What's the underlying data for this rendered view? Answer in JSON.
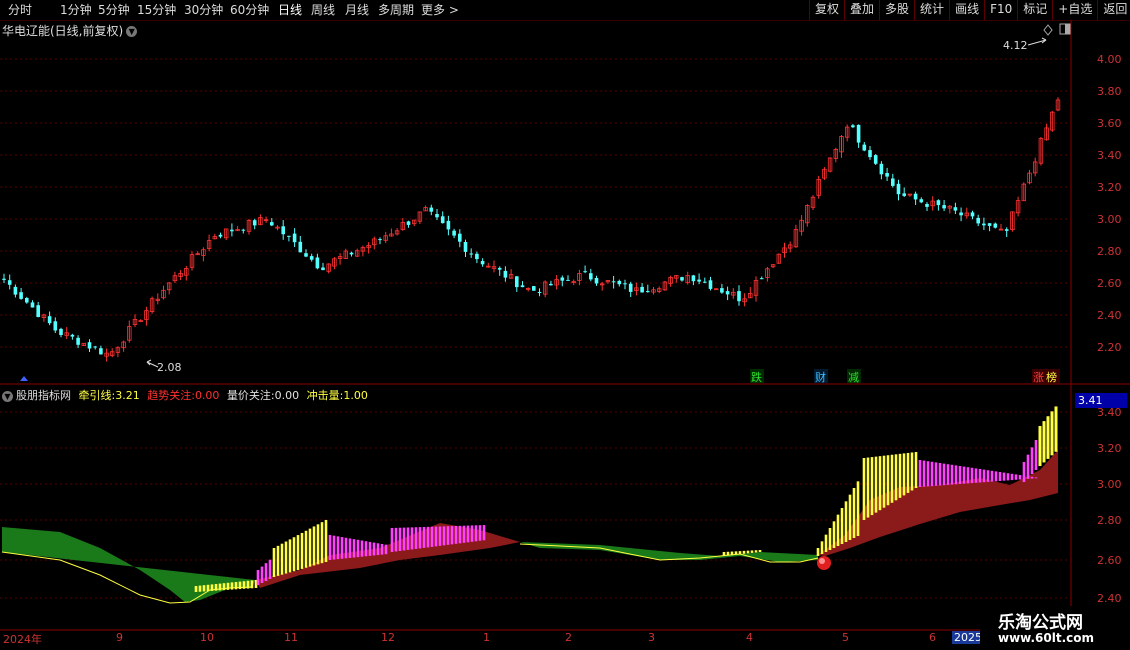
{
  "toolbar": {
    "periods": [
      "分时",
      "1分钟",
      "5分钟",
      "15分钟",
      "30分钟",
      "60分钟",
      "日线",
      "周线",
      "月线",
      "多周期",
      "更多 >"
    ],
    "active_period": "日线",
    "actions": [
      "复权",
      "叠加",
      "多股",
      "统计",
      "画线",
      "F10",
      "标记",
      "+自选",
      "返回"
    ]
  },
  "stock": {
    "title": "华电辽能(日线,前复权)"
  },
  "indicator": {
    "name": "股朋指标网",
    "items": [
      {
        "label": "牵引线:",
        "value": "3.21",
        "color": "#ffff40"
      },
      {
        "label": "趋势关注:",
        "value": "0.00",
        "color": "#ff3030"
      },
      {
        "label": "量价关注:",
        "value": "0.00",
        "color": "#e0e0e0"
      },
      {
        "label": "冲击量:",
        "value": "1.00",
        "color": "#ffff40"
      }
    ],
    "current_value": "3.41"
  },
  "price_axis": {
    "ticks": [
      "4.00",
      "3.80",
      "3.60",
      "3.40",
      "3.20",
      "3.00",
      "2.80",
      "2.60",
      "2.40",
      "2.20"
    ]
  },
  "indicator_axis": {
    "ticks": [
      "3.40",
      "3.20",
      "3.00",
      "2.80",
      "2.60",
      "2.40"
    ]
  },
  "annotations": {
    "high": "4.12",
    "low": "2.08"
  },
  "events": [
    {
      "text": "跌",
      "color": "#30e030",
      "bg": "#004000"
    },
    {
      "text": "财",
      "color": "#40c0ff",
      "bg": "#002040"
    },
    {
      "text": "减",
      "color": "#30e030",
      "bg": "#004000"
    },
    {
      "text": "涨",
      "color": "#ff4040",
      "bg": "#400000"
    },
    {
      "text": "榜",
      "color": "#ffff40",
      "bg": "#400000"
    }
  ],
  "date_axis": {
    "labels": [
      "2024年",
      "9",
      "10",
      "11",
      "12",
      "1",
      "2",
      "3",
      "4",
      "5",
      "6",
      "2025"
    ]
  },
  "watermark": {
    "title": "乐淘公式网",
    "url": "www.60lt.com"
  },
  "chart_data": {
    "type": "candlestick",
    "title": "华电辽能(日线,前复权)",
    "ylim": [
      2.1,
      4.2
    ],
    "high_marker": 4.12,
    "low_marker": 2.08,
    "close_trend": [
      {
        "x": "2024-08",
        "y": 2.62
      },
      {
        "x": "2024-09",
        "y": 2.3
      },
      {
        "x": "2024-09-20",
        "y": 2.15
      },
      {
        "x": "2024-10",
        "y": 2.55
      },
      {
        "x": "2024-10-20",
        "y": 2.9
      },
      {
        "x": "2024-11",
        "y": 3.0
      },
      {
        "x": "2024-11-20",
        "y": 2.7
      },
      {
        "x": "2024-12",
        "y": 2.85
      },
      {
        "x": "2024-12-20",
        "y": 3.05
      },
      {
        "x": "2025-01",
        "y": 2.75
      },
      {
        "x": "2025-01-20",
        "y": 2.55
      },
      {
        "x": "2025-02",
        "y": 2.65
      },
      {
        "x": "2025-03",
        "y": 2.55
      },
      {
        "x": "2025-03-20",
        "y": 2.65
      },
      {
        "x": "2025-04",
        "y": 2.5
      },
      {
        "x": "2025-04-20",
        "y": 2.9
      },
      {
        "x": "2025-05",
        "y": 3.6
      },
      {
        "x": "2025-05-20",
        "y": 3.15
      },
      {
        "x": "2025-06",
        "y": 3.05
      },
      {
        "x": "2025-06-10",
        "y": 2.9
      },
      {
        "x": "2025-06-20",
        "y": 3.75
      }
    ]
  }
}
